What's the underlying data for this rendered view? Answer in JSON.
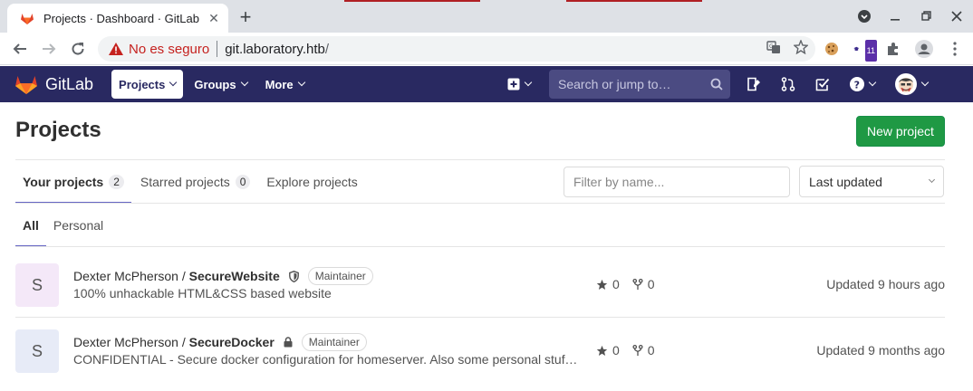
{
  "browser": {
    "tab_title": "Projects · Dashboard · GitLab",
    "insecure_label": "No es seguro",
    "url_host": "git.laboratory.htb",
    "url_rest": "/",
    "extension_badge": "11"
  },
  "navbar": {
    "brand": "GitLab",
    "menu": [
      "Projects",
      "Groups",
      "More"
    ],
    "search_placeholder": "Search or jump to…"
  },
  "page": {
    "title": "Projects",
    "new_project_label": "New project"
  },
  "tabs": [
    {
      "label": "Your projects",
      "count": "2"
    },
    {
      "label": "Starred projects",
      "count": "0"
    },
    {
      "label": "Explore projects"
    }
  ],
  "filter": {
    "placeholder": "Filter by name..."
  },
  "sort": {
    "selected": "Last updated"
  },
  "subtabs": [
    "All",
    "Personal"
  ],
  "projects": [
    {
      "avatar_letter": "S",
      "avatar_bg": "#f4e8f8",
      "namespace": "Dexter McPherson / ",
      "name": "SecureWebsite",
      "visibility_icon": "shield-icon",
      "role": "Maintainer",
      "description": "100% unhackable HTML&CSS based website",
      "stars": "0",
      "forks": "0",
      "updated": "Updated 9 hours ago"
    },
    {
      "avatar_letter": "S",
      "avatar_bg": "#e7ebf7",
      "namespace": "Dexter McPherson / ",
      "name": "SecureDocker",
      "visibility_icon": "lock-icon",
      "role": "Maintainer",
      "description": "CONFIDENTIAL - Secure docker configuration for homeserver. Also some personal stuff, I'll figure that out later.",
      "stars": "0",
      "forks": "0",
      "updated": "Updated 9 months ago"
    }
  ],
  "colors": {
    "navbar": "#292961",
    "accent": "#6666c4",
    "primary_button": "#1f9944"
  }
}
